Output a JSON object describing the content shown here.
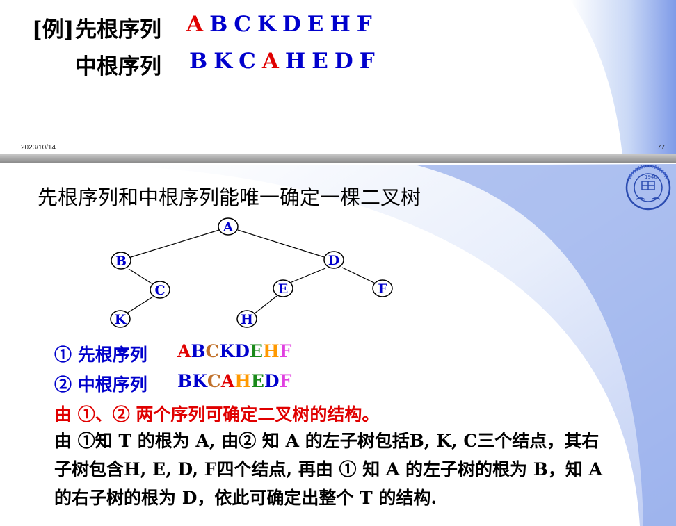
{
  "slide1": {
    "example_label": "[例]",
    "preorder_label": "先根序列",
    "preorder_seq": [
      "A",
      "B",
      "C",
      "K",
      "D",
      "E",
      "H",
      "F"
    ],
    "inorder_label": "中根序列",
    "inorder_seq": [
      "B",
      "K",
      "C",
      "A",
      "H",
      "E",
      "D",
      "F"
    ],
    "highlight_color": "#e00000",
    "seq_color": "#0000cc",
    "date": "2023/10/14",
    "page_number": "77"
  },
  "slide2": {
    "heading": "先根序列和中根序列能唯一确定一棵二叉树",
    "logo_text": "JILIN UNIVERSITY CHINA",
    "logo_year": "1946",
    "tree": {
      "nodes": [
        "A",
        "B",
        "D",
        "C",
        "E",
        "F",
        "K",
        "H"
      ]
    },
    "line1_prefix": "① 先根序列",
    "line1_letters": [
      {
        "ch": "A",
        "color": "#e00000"
      },
      {
        "ch": "B",
        "color": "#0000cc"
      },
      {
        "ch": "C",
        "color": "#c0712b"
      },
      {
        "ch": "K",
        "color": "#0000cc"
      },
      {
        "ch": "D",
        "color": "#0000cc"
      },
      {
        "ch": "E",
        "color": "#1a8a1a"
      },
      {
        "ch": "H",
        "color": "#ff9900"
      },
      {
        "ch": "F",
        "color": "#e040e0"
      }
    ],
    "line2_prefix": "② 中根序列",
    "line2_letters": [
      {
        "ch": "B",
        "color": "#0000cc"
      },
      {
        "ch": "K",
        "color": "#0000cc"
      },
      {
        "ch": "C",
        "color": "#c0712b"
      },
      {
        "ch": "A",
        "color": "#e00000"
      },
      {
        "ch": "H",
        "color": "#ff9900"
      },
      {
        "ch": "E",
        "color": "#1a8a1a"
      },
      {
        "ch": "D",
        "color": "#0000cc"
      },
      {
        "ch": "F",
        "color": "#e040e0"
      }
    ],
    "line3": "由 ①、② 两个序列可确定二叉树的结构。",
    "paragraph": [
      "由 ①知 T 的根为 A, 由② 知 A 的左子树包括B, K, C三个结点，其右",
      "子树包含H, E, D, F四个结点, 再由 ① 知 A 的左子树的根为 B，知 A",
      "的右子树的根为 D，依此可确定出整个 T 的结构."
    ]
  }
}
